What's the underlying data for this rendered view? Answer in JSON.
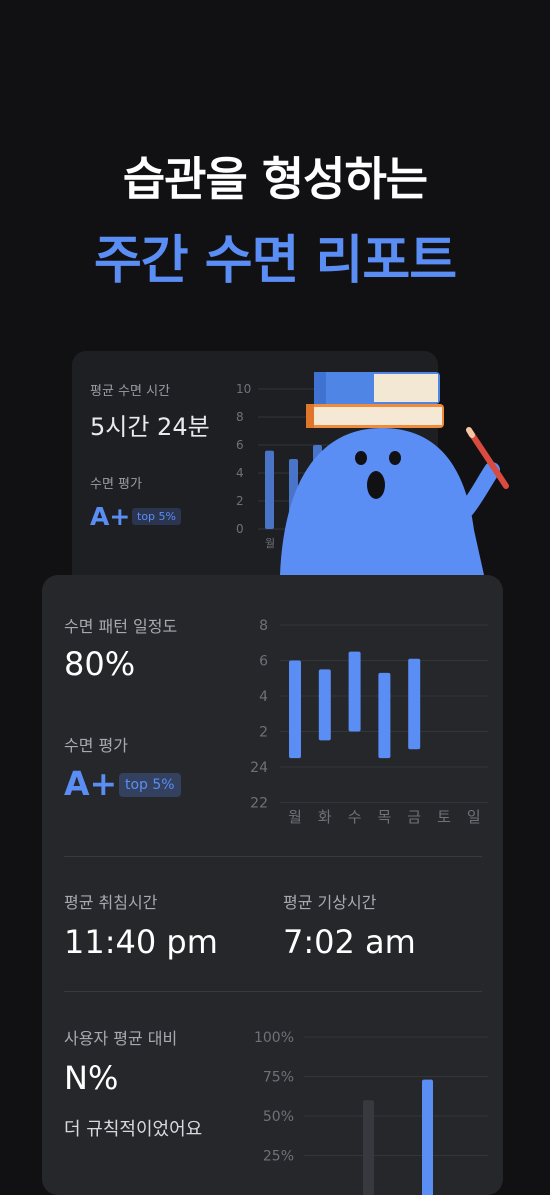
{
  "headline": {
    "line1": "습관을 형성하는",
    "line2": "주간 수면 리포트"
  },
  "back_card": {
    "avg_sleep_label": "평균 수면 시간",
    "avg_sleep_value": "5시간 24분",
    "rating_label": "수면 평가",
    "rating_value": "A+",
    "rating_badge": "top 5%",
    "chart_data": {
      "type": "bar",
      "y_ticks": [
        "10",
        "8",
        "6",
        "4",
        "2",
        "0"
      ],
      "categories": [
        "월"
      ],
      "values": [
        5.6,
        5.0,
        6.0
      ],
      "ylim": [
        0,
        10
      ]
    }
  },
  "front_card": {
    "consistency_label": "수면 패턴 일정도",
    "consistency_value": "80%",
    "rating_label": "수면 평가",
    "rating_value": "A+",
    "rating_badge": "top 5%",
    "bedtime_label": "평균 취침시간",
    "bedtime_value": "11:40 pm",
    "wake_label": "평균 기상시간",
    "wake_value": "7:02 am",
    "compare_label": "사용자 평균 대비",
    "compare_value": "N%",
    "compare_desc": "더 규칙적이었어요",
    "sleep_chart": {
      "type": "bar",
      "y_ticks": [
        "8",
        "6",
        "4",
        "2",
        "24",
        "22"
      ],
      "categories": [
        "월",
        "화",
        "수",
        "목",
        "금",
        "토",
        "일"
      ],
      "ranges": [
        [
          24.5,
          6.0
        ],
        [
          25.5,
          5.5
        ],
        [
          26.0,
          6.5
        ],
        [
          24.5,
          5.3
        ],
        [
          25.0,
          6.1
        ],
        null,
        null
      ]
    },
    "compare_chart": {
      "type": "bar",
      "y_ticks": [
        "100%",
        "75%",
        "50%",
        "25%"
      ],
      "series": [
        {
          "values": [
            0.6
          ]
        },
        {
          "values": [
            0.73
          ]
        }
      ]
    }
  },
  "colors": {
    "accent": "#5b8ef5",
    "background": "#111113",
    "card": "#26272b",
    "card_back": "#1e1f23"
  }
}
